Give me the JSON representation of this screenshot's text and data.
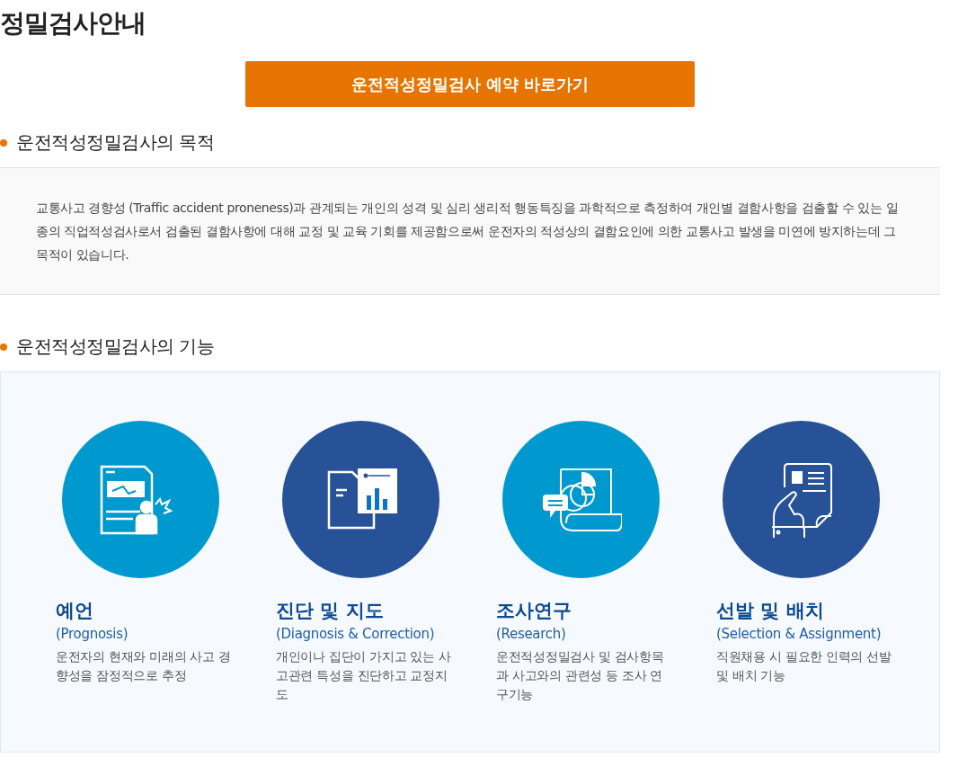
{
  "page_title": "정밀검사안내",
  "reserve_button": "운전적성정밀검사 예약 바로가기",
  "purpose": {
    "heading": "운전적성정밀검사의 목적",
    "text": "교통사고 경향성 (Traffic accident proneness)과 관계되는 개인의 성격 및 심리 생리적 행동특징을 과학적으로 측정하여 개인별 결함사항을 검출할 수 있는 일종의 직업적성검사로서 검출된 결함사항에 대해 교정 및 교육 기회를 제공함으로써 운전자의 적성상의 결함요인에 의한 교통사고 발생을 미연에 방지하는데 그 목적이 있습니다."
  },
  "functions": {
    "heading": "운전적성정밀검사의 기능",
    "items": [
      {
        "kind": "prognosis",
        "color": "#0099cf",
        "title": "예언",
        "subtitle": "(Prognosis)",
        "description": "운전자의 현재와 미래의 사고 경향성을 잠정적으로 추정"
      },
      {
        "kind": "diagnosis",
        "color": "#285298",
        "title": "진단 및 지도",
        "subtitle": "(Diagnosis & Correction)",
        "description": "개인이나 집단이 가지고 있는 사고관련 특성을 진단하고 교정지도"
      },
      {
        "kind": "research",
        "color": "#0099cf",
        "title": "조사연구",
        "subtitle": "(Research)",
        "description": "운전적성정밀검사 및 검사항목 과 사고와의 관련성 등 조사 연구기능"
      },
      {
        "kind": "selection",
        "color": "#285298",
        "title": "선발 및 배치",
        "subtitle": "(Selection & Assignment)",
        "description": "직원채용 시 필요한 인력의 선발 및 배치 기능"
      }
    ]
  }
}
